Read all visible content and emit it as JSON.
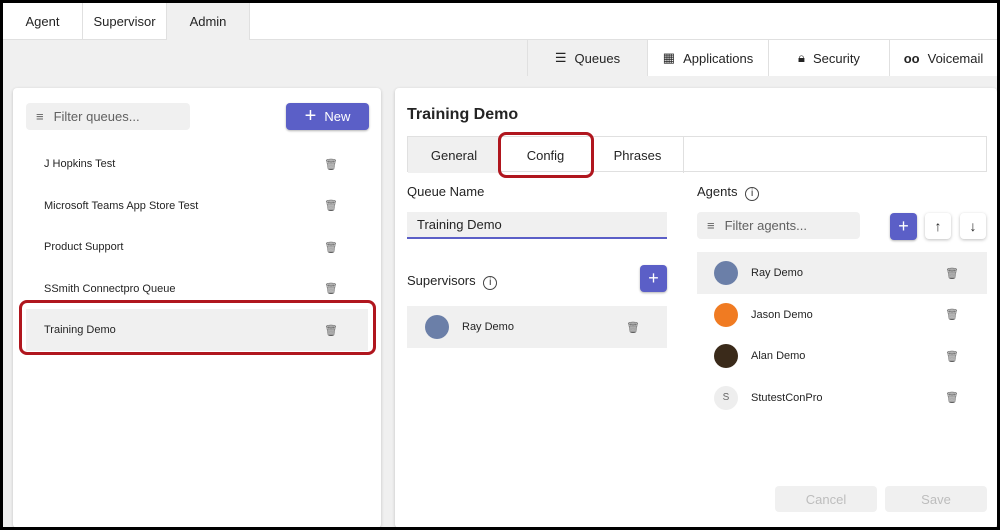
{
  "top_tabs": [
    "Agent",
    "Supervisor",
    "Admin"
  ],
  "sub_tabs": [
    {
      "label": "Queues",
      "icon": "list-icon"
    },
    {
      "label": "Applications",
      "icon": "apps-icon"
    },
    {
      "label": "Security",
      "icon": "lock-icon"
    },
    {
      "label": "Voicemail",
      "icon": "voicemail-icon"
    }
  ],
  "queues": {
    "filter_placeholder": "Filter queues...",
    "new_label": "New",
    "items": [
      "J Hopkins Test",
      "Microsoft Teams App Store Test",
      "Product Support",
      "SSmith Connectpro Queue",
      "Training Demo"
    ]
  },
  "detail": {
    "title": "Training Demo",
    "tabs": [
      "General",
      "Config",
      "Phrases"
    ],
    "queue_name_label": "Queue Name",
    "queue_name_value": "Training Demo",
    "supervisors_label": "Supervisors",
    "supervisors": [
      "Ray Demo"
    ],
    "agents_label": "Agents",
    "agents_filter_placeholder": "Filter agents...",
    "agents": [
      {
        "name": "Ray Demo",
        "initial": ""
      },
      {
        "name": "Jason Demo",
        "initial": ""
      },
      {
        "name": "Alan Demo",
        "initial": ""
      },
      {
        "name": "StutestConPro",
        "initial": "S"
      }
    ],
    "cancel_label": "Cancel",
    "save_label": "Save"
  },
  "colors": {
    "accent": "#5b5fc7",
    "highlight": "#b0161e"
  }
}
